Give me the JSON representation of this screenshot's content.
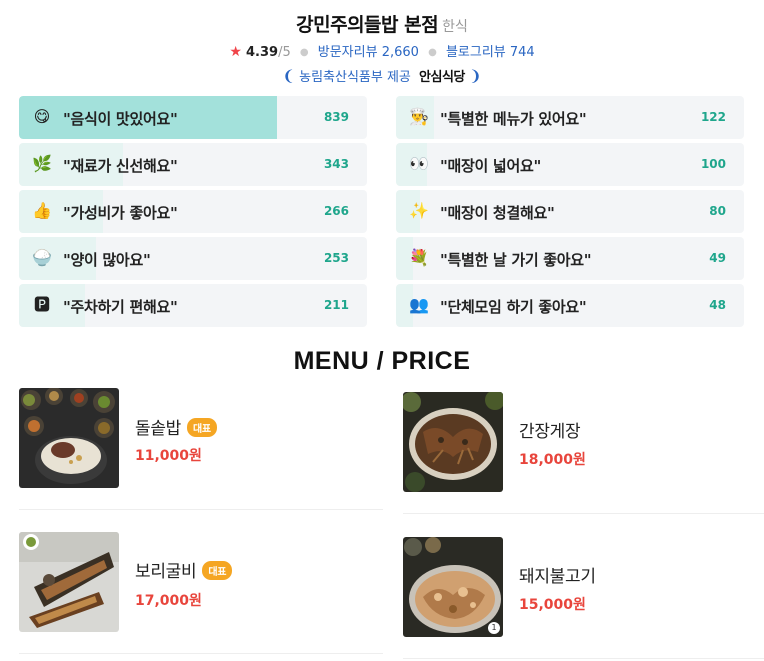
{
  "restaurant": {
    "name": "강민주의들밥 본점",
    "category": "한식",
    "rating": "4.39",
    "rating_max": "/5",
    "visitor_reviews": "방문자리뷰 2,660",
    "blog_reviews": "블로그리뷰 744",
    "certification_prefix": "농림축산식품부 제공",
    "certification_name": "안심식당"
  },
  "stats": {
    "left": [
      {
        "emoji": "😋",
        "label": "\"음식이 맛있어요\"",
        "count": "839",
        "fill_fraction": 0.74
      },
      {
        "emoji": "🌿",
        "label": "\"재료가 신선해요\"",
        "count": "343",
        "fill_fraction": 0.3
      },
      {
        "emoji": "👍",
        "label": "\"가성비가 좋아요\"",
        "count": "266",
        "fill_fraction": 0.24
      },
      {
        "emoji": "🍚",
        "label": "\"양이 많아요\"",
        "count": "253",
        "fill_fraction": 0.22
      },
      {
        "emoji": "🅿",
        "label": "\"주차하기 편해요\"",
        "count": "211",
        "fill_fraction": 0.19
      }
    ],
    "right": [
      {
        "emoji": "👨‍🍳",
        "label": "\"특별한 메뉴가 있어요\"",
        "count": "122",
        "fill_fraction": 0.11
      },
      {
        "emoji": "👀",
        "label": "\"매장이 넓어요\"",
        "count": "100",
        "fill_fraction": 0.09
      },
      {
        "emoji": "✨",
        "label": "\"매장이 청결해요\"",
        "count": "80",
        "fill_fraction": 0.07
      },
      {
        "emoji": "💐",
        "label": "\"특별한 날 가기 좋아요\"",
        "count": "49",
        "fill_fraction": 0.05
      },
      {
        "emoji": "👥",
        "label": "\"단체모임 하기 좋아요\"",
        "count": "48",
        "fill_fraction": 0.05
      }
    ]
  },
  "menu": {
    "heading": "MENU / PRICE",
    "representative_label": "대표",
    "items": [
      {
        "name": "돌솥밥",
        "price": "11,000원",
        "representative": true,
        "image": "stone-pot-rice-photo"
      },
      {
        "name": "간장게장",
        "price": "18,000원",
        "representative": false,
        "image": "soy-crab-photo"
      },
      {
        "name": "보리굴비",
        "price": "17,000원",
        "representative": true,
        "image": "dried-croaker-photo"
      },
      {
        "name": "돼지불고기",
        "price": "15,000원",
        "representative": false,
        "image": "pork-bulgogi-photo",
        "photo_count": "1"
      }
    ]
  },
  "colors": {
    "accent_fill": "#a3e1db",
    "count_green": "#1fa68c",
    "price_red": "#e8453c",
    "link_blue": "#2a66c2",
    "badge_orange": "#f5a623"
  }
}
